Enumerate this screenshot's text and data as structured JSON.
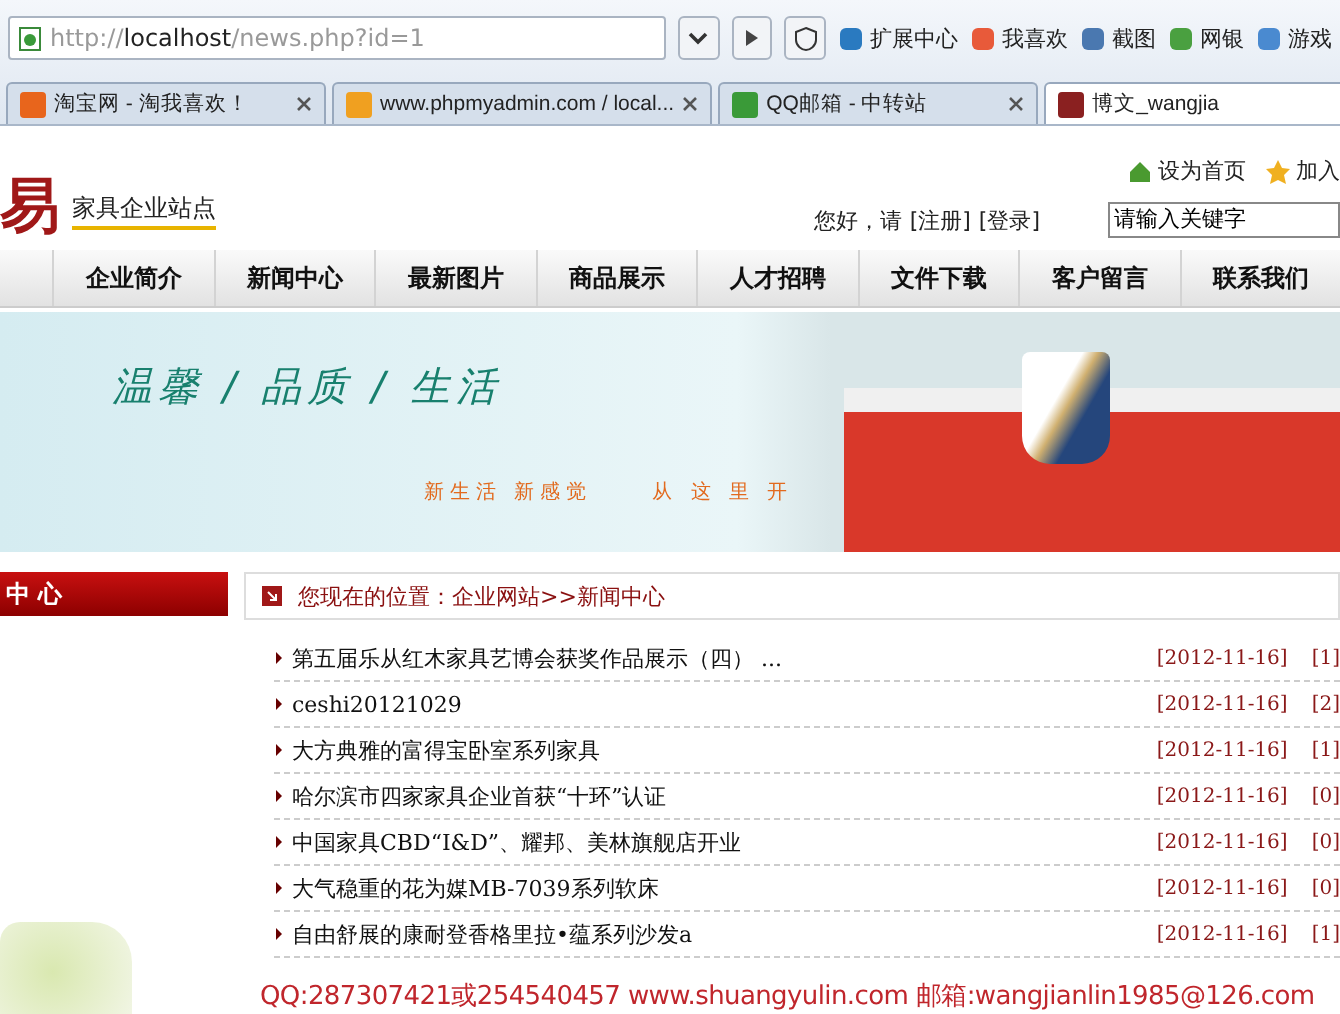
{
  "browser": {
    "address": {
      "host": "localhost",
      "path": "/news.php?id=1",
      "scheme": "http://"
    },
    "toolbar": [
      "扩展中心",
      "我喜欢",
      "截图",
      "网银",
      "游戏"
    ],
    "tabs": [
      {
        "title": "淘宝网 - 淘我喜欢！",
        "selected": false
      },
      {
        "title": "www.phpmyadmin.com / local...",
        "selected": false
      },
      {
        "title": "QQ邮箱 - 中转站",
        "selected": false
      },
      {
        "title": "博文_wangjia",
        "selected": true
      }
    ]
  },
  "header": {
    "logo": "易",
    "site_name": "家具企业站点",
    "links": [
      "设为首页",
      "加入"
    ],
    "greeting": "您好，请",
    "auth": [
      "[注册]",
      "[登录]"
    ],
    "search": {
      "placeholder": "请输入关键字"
    }
  },
  "nav": [
    "企业简介",
    "新闻中心",
    "最新图片",
    "商品展示",
    "人才招聘",
    "文件下载",
    "客户留言",
    "联系我们"
  ],
  "banner": {
    "tagline": "温馨 / 品质 / 生活",
    "slogan": "新生活  新感觉",
    "slogan_2": "从 这 里 开"
  },
  "sidebar": {
    "title": "中 心"
  },
  "breadcrumb": "您现在的位置：企业网站>>新闻中心",
  "news": [
    {
      "title": "第五届乐从红木家具艺博会获奖作品展示（四） ...",
      "date": "[2012-11-16]",
      "count": "[1]"
    },
    {
      "title": "ceshi20121029",
      "date": "[2012-11-16]",
      "count": "[2]"
    },
    {
      "title": "大方典雅的富得宝卧室系列家具",
      "date": "[2012-11-16]",
      "count": "[1]"
    },
    {
      "title": "哈尔滨市四家家具企业首获“十环”认证",
      "date": "[2012-11-16]",
      "count": "[0]"
    },
    {
      "title": "中国家具CBD“I&D”、耀邦、美林旗舰店开业",
      "date": "[2012-11-16]",
      "count": "[0]"
    },
    {
      "title": "大气稳重的花为媒MB-7039系列软床",
      "date": "[2012-11-16]",
      "count": "[0]"
    },
    {
      "title": "自由舒展的康耐登香格里拉•蕴系列沙发a",
      "date": "[2012-11-16]",
      "count": "[1]"
    }
  ],
  "contact": "QQ:287307421或254540457 www.shuangyulin.com 邮箱:wangjianlin1985@126.com"
}
